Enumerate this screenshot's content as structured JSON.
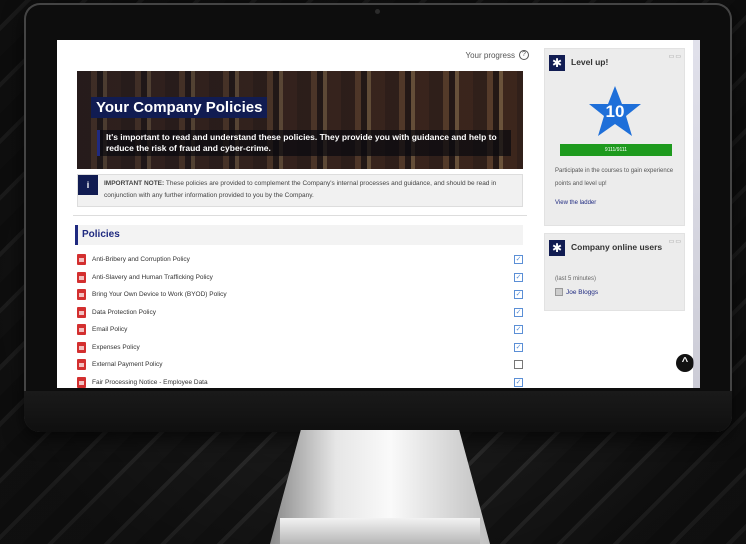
{
  "main": {
    "progress_label": "Your progress",
    "banner": {
      "title": "Your Company Policies",
      "subtitle": "It's important to read and understand these policies. They provide you with guidance and help to reduce the risk of fraud and cyber-crime."
    },
    "note": {
      "label": "IMPORTANT NOTE:",
      "text": " These policies are provided to complement the Company's internal processes and guidance, and should be read in conjunction with any further information provided to you by the Company."
    },
    "policies_heading": "Policies",
    "policies": [
      {
        "title": "Anti-Bribery and Corruption Policy",
        "completed": true
      },
      {
        "title": "Anti-Slavery and Human Trafficking Policy",
        "completed": true
      },
      {
        "title": "Bring Your Own Device to Work (BYOD) Policy",
        "completed": true
      },
      {
        "title": "Data Protection Policy",
        "completed": true
      },
      {
        "title": "Email Policy",
        "completed": true
      },
      {
        "title": "Expenses Policy",
        "completed": true
      },
      {
        "title": "External Payment Policy",
        "completed": false
      },
      {
        "title": "Fair Processing Notice - Employee Data",
        "completed": true
      }
    ]
  },
  "level_block": {
    "title": "Level up!",
    "level": "10",
    "points": "9111/9111",
    "description": "Participate in the courses to gain experience points and level up!",
    "link": "View the ladder"
  },
  "online_block": {
    "title": "Company online users",
    "meta": "(last 5 minutes)",
    "user": "Joe Bloggs"
  },
  "colors": {
    "brand_navy": "#111c52",
    "accent_green": "#1e9a1e",
    "pdf_red": "#d32f2f",
    "star_blue": "#1e6fd9"
  }
}
